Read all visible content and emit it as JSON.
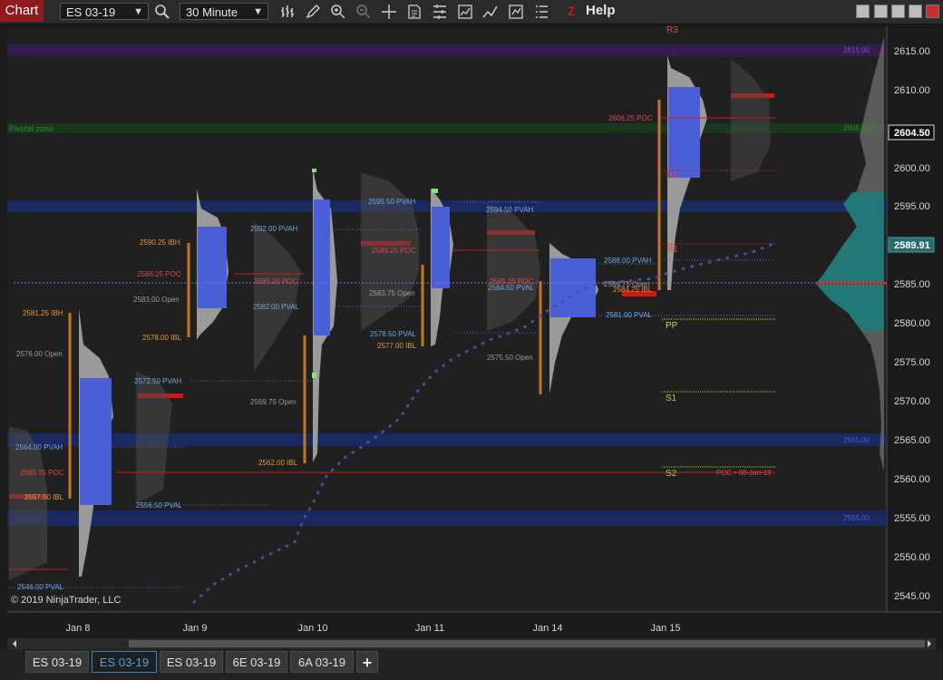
{
  "toolbar": {
    "chart_button": "Chart",
    "instrument": "ES 03-19",
    "interval": "30 Minute",
    "help": "Help",
    "icons": [
      "search-icon",
      "bar-type-icon",
      "draw-tool-icon",
      "zoom-in-icon",
      "zoom-out-icon",
      "crosshair-icon",
      "data-box-icon",
      "properties-icon",
      "strategies-icon",
      "indicators-icon",
      "templates-icon",
      "chart-trader-icon",
      "ninja-z-icon"
    ]
  },
  "chart": {
    "copyright": "© 2019 NinjaTrader, LLC",
    "y_ticks": [
      "2615.00",
      "2610.00",
      "2605.00",
      "2600.00",
      "2595.00",
      "2590.00",
      "2585.00",
      "2580.00",
      "2575.00",
      "2570.00",
      "2565.00",
      "2560.00",
      "2555.00",
      "2550.00",
      "2545.00"
    ],
    "current_price_1": "2604.50",
    "current_price_2": "2589.91",
    "x_ticks": [
      "Jan 8",
      "Jan 9",
      "Jan 10",
      "Jan 11",
      "Jan 14",
      "Jan 15"
    ],
    "zone_label": "Pivotal zone",
    "pivots": [
      "R3",
      "R2",
      "R1",
      "PP",
      "S1",
      "S2"
    ],
    "poc_ref": "POC • 08-Jan-19",
    "labels": [
      "2590.25 IBH",
      "2586.25 POC",
      "2583.00 Open",
      "2578.00 IBL",
      "2581.25 IBH",
      "2576.00 Open",
      "2572.50 PVAH",
      "2592.00 PVAH",
      "2585.25 POC",
      "2582.00 PVAL",
      "2569.75 Open",
      "2562.00 IBL",
      "2564.00 PVAH",
      "2560.75 POC",
      "2557.50 IBL",
      "2556.50 PVAL",
      "2546.00 PVAL",
      "2595.50 PVAH",
      "2589.25 POC",
      "2583.75 Open",
      "2578.50 PVAL",
      "2577.00 IBL",
      "2594.50 PVAH",
      "2585.25 POC",
      "2584.50 PVAL",
      "2575.50 Open",
      "2588.00 PVAH",
      "2584.75 Open",
      "2584.25 IBL",
      "2581.00 PVAL",
      "2606.25 POC"
    ],
    "right_zone_labels": [
      "2615.00",
      "2605.00",
      "2565.00",
      "2555.00"
    ]
  },
  "colors": {
    "background": "#202020",
    "profile_value_area": "#4a5fd6",
    "profile_gray": "#9a9a9a",
    "poc": "#d01818",
    "ib_line": "#c2761f",
    "pvah_text": "#6fa4e8",
    "poc_text": "#e04848",
    "open_text": "#9c9c9c",
    "ib_text": "#e59830",
    "pivot_green": "#9bd93a",
    "vwap_dot": "#4c4c9e"
  },
  "tabs": [
    "ES 03-19",
    "ES 03-19",
    "ES 03-19",
    "6E 03-19",
    "6A 03-19",
    "+"
  ],
  "active_tab_index": 1
}
